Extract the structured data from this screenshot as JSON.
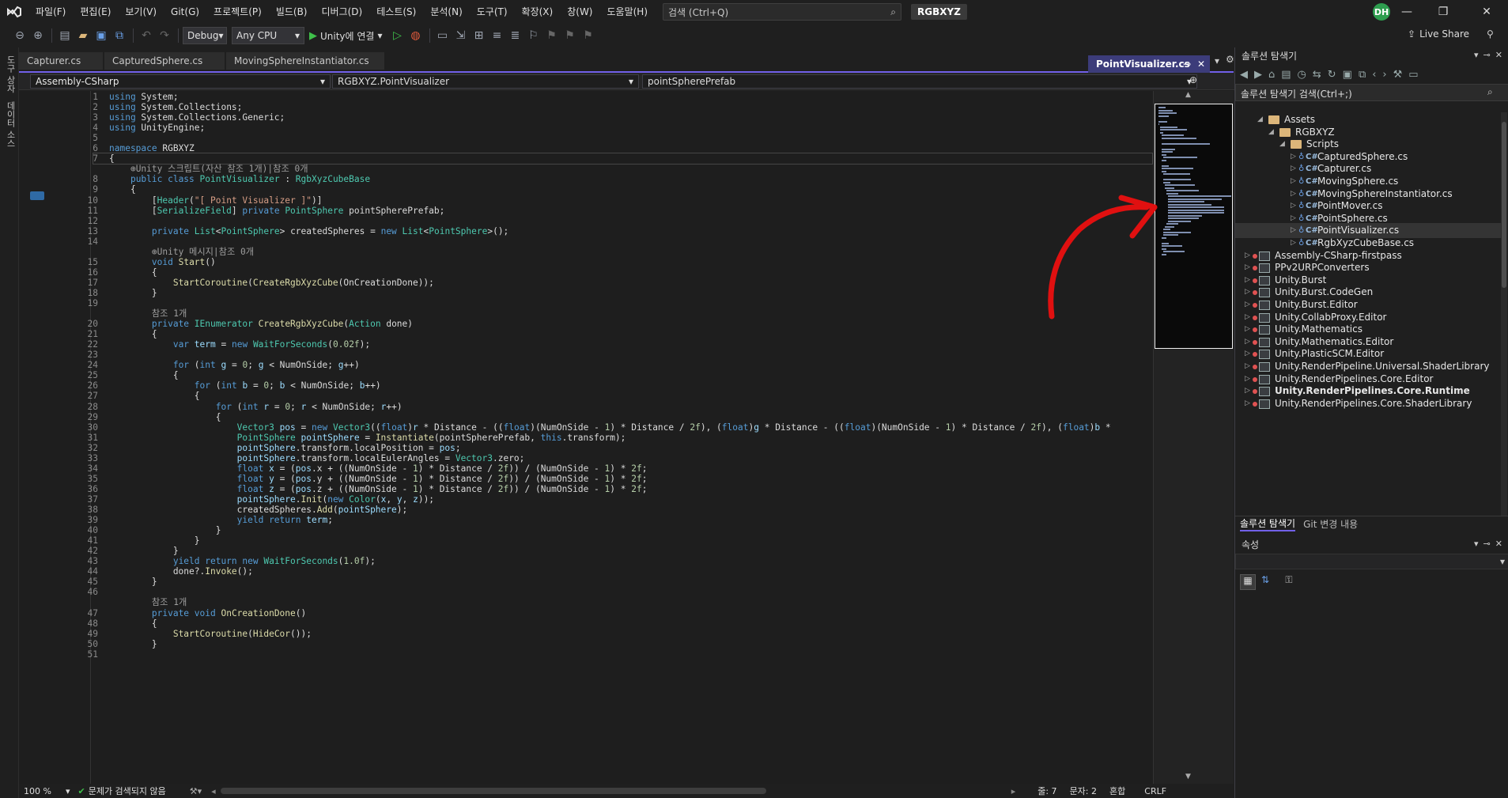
{
  "menubar": {
    "items": [
      "파일(F)",
      "편집(E)",
      "보기(V)",
      "Git(G)",
      "프로젝트(P)",
      "빌드(B)",
      "디버그(D)",
      "테스트(S)",
      "분석(N)",
      "도구(T)",
      "확장(X)",
      "창(W)",
      "도움말(H)"
    ],
    "search_placeholder": "검색 (Ctrl+Q)",
    "solution_name": "RGBXYZ",
    "avatar_initials": "DH"
  },
  "toolbar": {
    "config": "Debug",
    "platform": "Any CPU",
    "run_label": "Unity에 연결",
    "live_share": "Live Share"
  },
  "left_strip": {
    "tabs": [
      "도구 상자",
      "데이터 소스"
    ]
  },
  "tabs": {
    "items": [
      "Capturer.cs",
      "CapturedSphere.cs",
      "MovingSphereInstantiator.cs"
    ],
    "active": "PointVisualizer.cs"
  },
  "navbar": {
    "project": "Assembly-CSharp",
    "type": "RGBXYZ.PointVisualizer",
    "member": "pointSpherePrefab"
  },
  "code_lines": [
    {
      "n": "1",
      "h": "<span class='k'>using</span> System;"
    },
    {
      "n": "2",
      "h": "<span class='k'>using</span> System.Collections;"
    },
    {
      "n": "3",
      "h": "<span class='k'>using</span> System.Collections.Generic;"
    },
    {
      "n": "4",
      "h": "<span class='k'>using</span> UnityEngine;"
    },
    {
      "n": "5",
      "h": ""
    },
    {
      "n": "6",
      "h": "<span class='k'>namespace</span> RGBXYZ"
    },
    {
      "n": "7",
      "h": "{"
    },
    {
      "n": "",
      "h": "    <span class='c'>⊕Unity 스크립트(자산 참조 1개)|참조 0개</span>"
    },
    {
      "n": "8",
      "h": "    <span class='k'>public class</span> <span class='t'>PointVisualizer</span> : <span class='t'>RgbXyzCubeBase</span>"
    },
    {
      "n": "9",
      "h": "    {"
    },
    {
      "n": "10",
      "h": "        [<span class='t'>Header</span>(<span class='s'>\"[ Point Visualizer ]\"</span>)]"
    },
    {
      "n": "11",
      "h": "        [<span class='t'>SerializeField</span>] <span class='k'>private</span> <span class='t'>PointSphere</span> pointSpherePrefab;"
    },
    {
      "n": "12",
      "h": ""
    },
    {
      "n": "13",
      "h": "        <span class='k'>private</span> <span class='t'>List</span>&lt;<span class='t'>PointSphere</span>&gt; createdSpheres = <span class='k'>new</span> <span class='t'>List</span>&lt;<span class='t'>PointSphere</span>&gt;();"
    },
    {
      "n": "14",
      "h": ""
    },
    {
      "n": "",
      "h": "        <span class='c'>⊕Unity 메시지|참조 0개</span>"
    },
    {
      "n": "15",
      "h": "        <span class='k'>void</span> <span class='m'>Start</span>()"
    },
    {
      "n": "16",
      "h": "        {"
    },
    {
      "n": "17",
      "h": "            <span class='m'>StartCoroutine</span>(<span class='m'>CreateRgbXyzCube</span>(OnCreationDone));"
    },
    {
      "n": "18",
      "h": "        }"
    },
    {
      "n": "19",
      "h": ""
    },
    {
      "n": "",
      "h": "        <span class='c'>참조 1개</span>"
    },
    {
      "n": "20",
      "h": "        <span class='k'>private</span> <span class='t'>IEnumerator</span> <span class='m'>CreateRgbXyzCube</span>(<span class='t'>Action</span> done)"
    },
    {
      "n": "21",
      "h": "        {"
    },
    {
      "n": "22",
      "h": "            <span class='k'>var</span> <span class='p'>term</span> = <span class='k'>new</span> <span class='t'>WaitForSeconds</span>(<span class='n'>0.02f</span>);"
    },
    {
      "n": "23",
      "h": ""
    },
    {
      "n": "24",
      "h": "            <span class='k'>for</span> (<span class='k'>int</span> <span class='p'>g</span> = <span class='n'>0</span>; <span class='p'>g</span> &lt; NumOnSide; <span class='p'>g</span>++)"
    },
    {
      "n": "25",
      "h": "            {"
    },
    {
      "n": "26",
      "h": "                <span class='k'>for</span> (<span class='k'>int</span> <span class='p'>b</span> = <span class='n'>0</span>; <span class='p'>b</span> &lt; NumOnSide; <span class='p'>b</span>++)"
    },
    {
      "n": "27",
      "h": "                {"
    },
    {
      "n": "28",
      "h": "                    <span class='k'>for</span> (<span class='k'>int</span> <span class='p'>r</span> = <span class='n'>0</span>; <span class='p'>r</span> &lt; NumOnSide; <span class='p'>r</span>++)"
    },
    {
      "n": "29",
      "h": "                    {"
    },
    {
      "n": "30",
      "h": "                        <span class='t'>Vector3</span> <span class='p'>pos</span> = <span class='k'>new</span> <span class='t'>Vector3</span>((<span class='k'>float</span>)<span class='p'>r</span> * Distance - ((<span class='k'>float</span>)(NumOnSide - <span class='n'>1</span>) * Distance / <span class='n'>2f</span>), (<span class='k'>float</span>)<span class='p'>g</span> * Distance - ((<span class='k'>float</span>)(NumOnSide - <span class='n'>1</span>) * Distance / <span class='n'>2f</span>), (<span class='k'>float</span>)<span class='p'>b</span> *"
    },
    {
      "n": "31",
      "h": "                        <span class='t'>PointSphere</span> <span class='p'>pointSphere</span> = <span class='m'>Instantiate</span>(pointSpherePrefab, <span class='k'>this</span>.transform);"
    },
    {
      "n": "32",
      "h": "                        <span class='p'>pointSphere</span>.transform.localPosition = <span class='p'>pos</span>;"
    },
    {
      "n": "33",
      "h": "                        <span class='p'>pointSphere</span>.transform.localEulerAngles = <span class='t'>Vector3</span>.zero;"
    },
    {
      "n": "34",
      "h": "                        <span class='k'>float</span> <span class='p'>x</span> = (<span class='p'>pos</span>.x + ((NumOnSide - <span class='n'>1</span>) * Distance / <span class='n'>2f</span>)) / (NumOnSide - <span class='n'>1</span>) * <span class='n'>2f</span>;"
    },
    {
      "n": "35",
      "h": "                        <span class='k'>float</span> <span class='p'>y</span> = (<span class='p'>pos</span>.y + ((NumOnSide - <span class='n'>1</span>) * Distance / <span class='n'>2f</span>)) / (NumOnSide - <span class='n'>1</span>) * <span class='n'>2f</span>;"
    },
    {
      "n": "36",
      "h": "                        <span class='k'>float</span> <span class='p'>z</span> = (<span class='p'>pos</span>.z + ((NumOnSide - <span class='n'>1</span>) * Distance / <span class='n'>2f</span>)) / (NumOnSide - <span class='n'>1</span>) * <span class='n'>2f</span>;"
    },
    {
      "n": "37",
      "h": "                        <span class='p'>pointSphere</span>.<span class='m'>Init</span>(<span class='k'>new</span> <span class='t'>Color</span>(<span class='p'>x</span>, <span class='p'>y</span>, <span class='p'>z</span>));"
    },
    {
      "n": "38",
      "h": "                        createdSpheres.<span class='m'>Add</span>(<span class='p'>pointSphere</span>);"
    },
    {
      "n": "39",
      "h": "                        <span class='k'>yield return</span> <span class='p'>term</span>;"
    },
    {
      "n": "40",
      "h": "                    }"
    },
    {
      "n": "41",
      "h": "                }"
    },
    {
      "n": "42",
      "h": "            }"
    },
    {
      "n": "43",
      "h": "            <span class='k'>yield return new</span> <span class='t'>WaitForSeconds</span>(<span class='n'>1.0f</span>);"
    },
    {
      "n": "44",
      "h": "            done?.<span class='m'>Invoke</span>();"
    },
    {
      "n": "45",
      "h": "        }"
    },
    {
      "n": "46",
      "h": ""
    },
    {
      "n": "",
      "h": "        <span class='c'>참조 1개</span>"
    },
    {
      "n": "47",
      "h": "        <span class='k'>private void</span> <span class='m'>OnCreationDone</span>()"
    },
    {
      "n": "48",
      "h": "        {"
    },
    {
      "n": "49",
      "h": "            <span class='m'>StartCoroutine</span>(<span class='m'>HideCor</span>());"
    },
    {
      "n": "50",
      "h": "        }"
    },
    {
      "n": "51",
      "h": ""
    }
  ],
  "statusbar": {
    "zoom": "100 %",
    "issues": "문제가 검색되지 않음",
    "line": "줄: 7",
    "col": "문자: 2",
    "mixed": "혼합",
    "eol": "CRLF"
  },
  "solution_explorer": {
    "title": "솔루션 탐색기",
    "search_placeholder": "솔루션 탐색기 검색(Ctrl+;)",
    "items": [
      {
        "label": "Assets",
        "kind": "folder",
        "level": 1,
        "open": true
      },
      {
        "label": "RGBXYZ",
        "kind": "folder",
        "level": 2,
        "open": true
      },
      {
        "label": "Scripts",
        "kind": "folder",
        "level": 3,
        "open": true
      },
      {
        "label": "CapturedSphere.cs",
        "kind": "cs",
        "level": 4
      },
      {
        "label": "Capturer.cs",
        "kind": "cs",
        "level": 4
      },
      {
        "label": "MovingSphere.cs",
        "kind": "cs",
        "level": 4
      },
      {
        "label": "MovingSphereInstantiator.cs",
        "kind": "cs",
        "level": 4
      },
      {
        "label": "PointMover.cs",
        "kind": "cs",
        "level": 4
      },
      {
        "label": "PointSphere.cs",
        "kind": "cs",
        "level": 4
      },
      {
        "label": "PointVisualizer.cs",
        "kind": "cs",
        "level": 4,
        "selected": true
      },
      {
        "label": "RgbXyzCubeBase.cs",
        "kind": "cs",
        "level": 4
      },
      {
        "label": "Assembly-CSharp-firstpass",
        "kind": "proj",
        "level": 0
      },
      {
        "label": "PPv2URPConverters",
        "kind": "proj",
        "level": 0
      },
      {
        "label": "Unity.Burst",
        "kind": "proj",
        "level": 0
      },
      {
        "label": "Unity.Burst.CodeGen",
        "kind": "proj",
        "level": 0
      },
      {
        "label": "Unity.Burst.Editor",
        "kind": "proj",
        "level": 0
      },
      {
        "label": "Unity.CollabProxy.Editor",
        "kind": "proj",
        "level": 0
      },
      {
        "label": "Unity.Mathematics",
        "kind": "proj",
        "level": 0
      },
      {
        "label": "Unity.Mathematics.Editor",
        "kind": "proj",
        "level": 0
      },
      {
        "label": "Unity.PlasticSCM.Editor",
        "kind": "proj",
        "level": 0
      },
      {
        "label": "Unity.RenderPipeline.Universal.ShaderLibrary",
        "kind": "proj",
        "level": 0
      },
      {
        "label": "Unity.RenderPipelines.Core.Editor",
        "kind": "proj",
        "level": 0
      },
      {
        "label": "Unity.RenderPipelines.Core.Runtime",
        "kind": "proj",
        "level": 0,
        "bold": true
      },
      {
        "label": "Unity.RenderPipelines.Core.ShaderLibrary",
        "kind": "proj",
        "level": 0
      }
    ],
    "bottom_tabs": [
      "솔루션 탐색기",
      "Git 변경 내용"
    ]
  },
  "properties": {
    "title": "속성"
  },
  "colors": {
    "accent": "#7160e8",
    "annotation_arrow": "#e01010"
  }
}
